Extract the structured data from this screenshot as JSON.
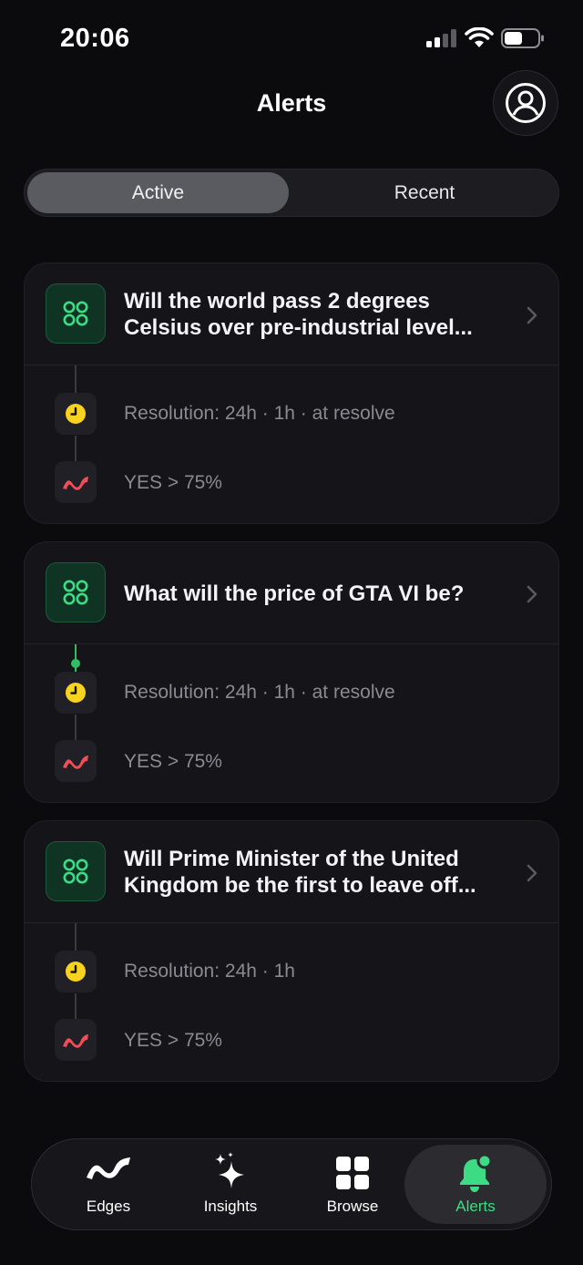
{
  "status_bar": {
    "time": "20:06"
  },
  "header": {
    "title": "Alerts"
  },
  "segments": {
    "active": "Active",
    "recent": "Recent"
  },
  "alerts": [
    {
      "title": "Will the world pass 2 degrees Celsius over pre-industrial level...",
      "resolution": "Resolution: 24h · 1h · at resolve",
      "condition": "YES > 75%"
    },
    {
      "title": "What will the price of GTA VI be?",
      "resolution": "Resolution: 24h · 1h · at resolve",
      "condition": "YES > 75%"
    },
    {
      "title": "Will Prime Minister of the United Kingdom be the first to leave off...",
      "resolution": "Resolution: 24h · 1h",
      "condition": "YES > 75%"
    }
  ],
  "tabs": [
    {
      "label": "Edges",
      "icon": "edges-icon"
    },
    {
      "label": "Insights",
      "icon": "sparkle-icon"
    },
    {
      "label": "Browse",
      "icon": "grid-icon"
    },
    {
      "label": "Alerts",
      "icon": "bell-icon"
    }
  ],
  "colors": {
    "accent": "#3ddc84",
    "clock": "#f7d21e",
    "trend": "#f04e57",
    "background": "#0b0b0e"
  }
}
